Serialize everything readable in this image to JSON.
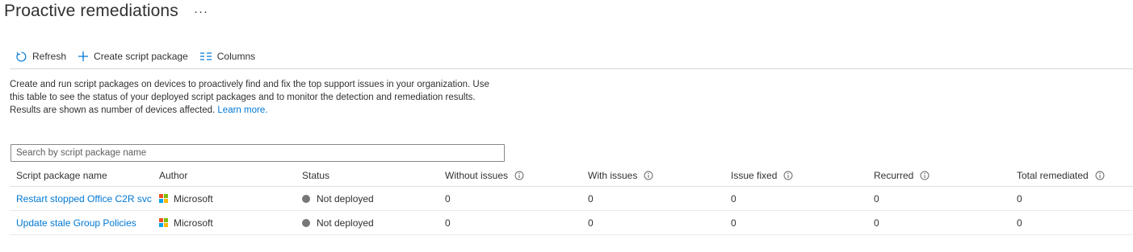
{
  "page": {
    "title": "Proactive remediations",
    "more_label": "···"
  },
  "toolbar": {
    "refresh_label": "Refresh",
    "create_label": "Create script package",
    "columns_label": "Columns"
  },
  "description": {
    "text": "Create and run script packages on devices to proactively find and fix the top support issues in your organization. Use this table to see the status of your deployed script packages and to monitor the detection and remediation results. Results are shown as number of devices affected. ",
    "link_label": "Learn more."
  },
  "search": {
    "placeholder": "Search by script package name"
  },
  "table": {
    "columns": [
      "Script package name",
      "Author",
      "Status",
      "Without issues",
      "With issues",
      "Issue fixed",
      "Recurred",
      "Total remediated"
    ],
    "rows": [
      {
        "name": "Restart stopped Office C2R svc",
        "author": "Microsoft",
        "status": "Not deployed",
        "without_issues": "0",
        "with_issues": "0",
        "issue_fixed": "0",
        "recurred": "0",
        "total_remediated": "0"
      },
      {
        "name": "Update stale Group Policies",
        "author": "Microsoft",
        "status": "Not deployed",
        "without_issues": "0",
        "with_issues": "0",
        "issue_fixed": "0",
        "recurred": "0",
        "total_remediated": "0"
      }
    ]
  },
  "colors": {
    "accent": "#0078d4",
    "status_not_deployed": "#797775",
    "ms_red": "#f25022",
    "ms_green": "#7fba00",
    "ms_blue": "#00a4ef",
    "ms_yellow": "#ffb900"
  },
  "icons": {
    "refresh": "refresh-icon",
    "create": "plus-icon",
    "columns": "columns-icon",
    "info": "info-icon",
    "author_logo": "microsoft-logo-icon",
    "status": "status-dot-icon"
  }
}
